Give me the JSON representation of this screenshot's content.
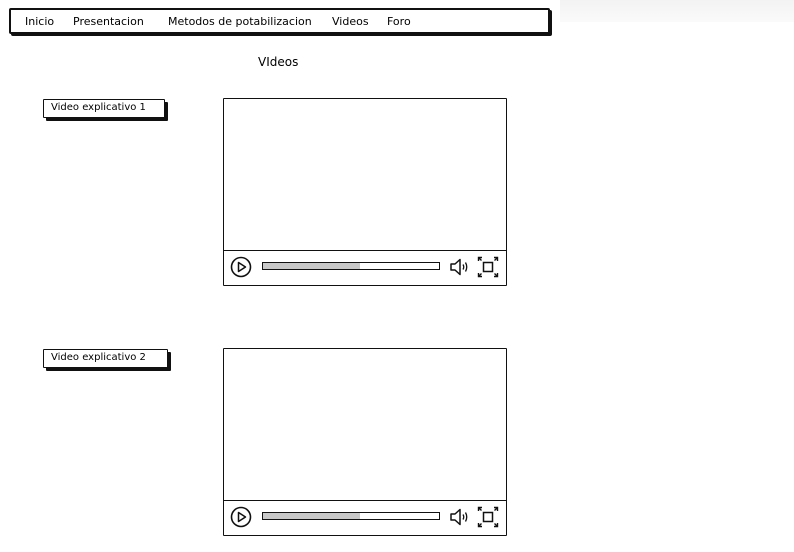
{
  "nav": {
    "items": [
      {
        "label": "Inicio"
      },
      {
        "label": "Presentacion"
      },
      {
        "label": "Metodos de potabilizacion"
      },
      {
        "label": "Videos"
      },
      {
        "label": "Foro"
      }
    ]
  },
  "page": {
    "title": "VIdeos"
  },
  "videos": [
    {
      "label": "Video explicativo 1",
      "progress": 0.55
    },
    {
      "label": "Video explicativo 2",
      "progress": 0.55
    }
  ],
  "icons": {
    "play": "play-icon",
    "volume": "volume-icon",
    "fullscreen": "fullscreen-icon"
  },
  "colors": {
    "stroke": "#111111",
    "progress_fill": "#c8c8c8",
    "background": "#ffffff"
  }
}
